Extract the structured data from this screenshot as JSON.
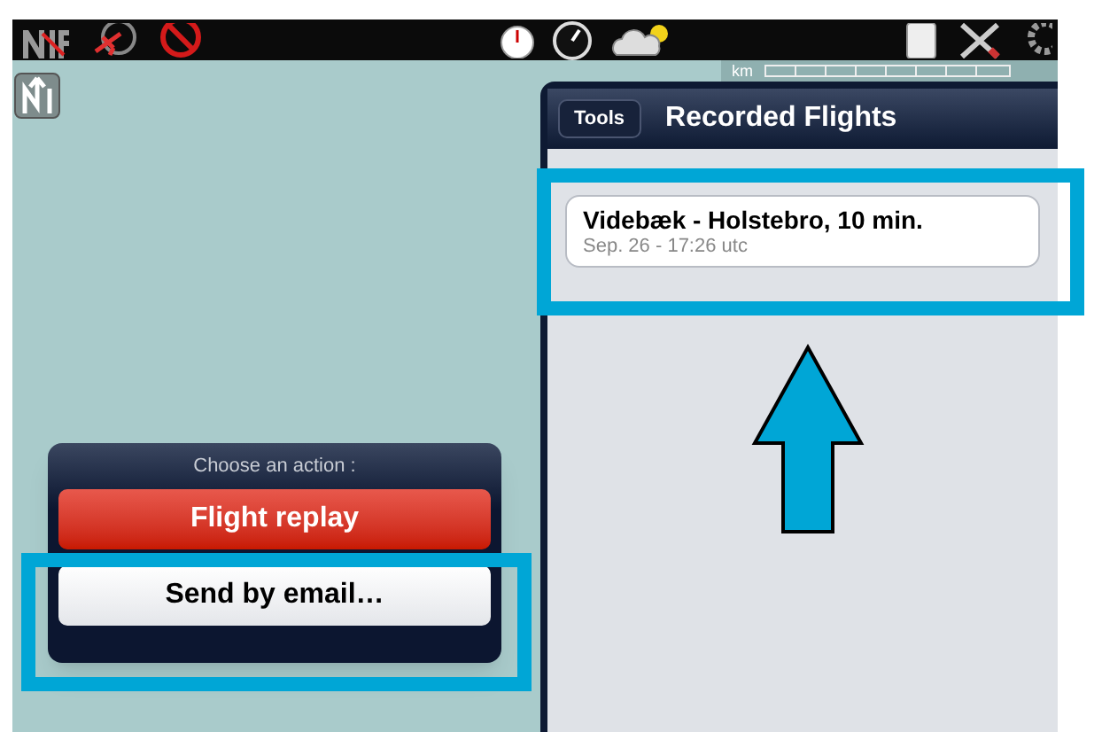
{
  "map": {
    "scale_unit": "km"
  },
  "popover": {
    "back_button": "Tools",
    "title": "Recorded Flights",
    "flights": [
      {
        "title": "Videbæk - Holstebro, 10 min.",
        "subtitle": "Sep. 26 - 17:26 utc"
      }
    ]
  },
  "action_sheet": {
    "title": "Choose an action :",
    "buttons": [
      {
        "label": "Flight replay",
        "kind": "destructive"
      },
      {
        "label": "Send by email…",
        "kind": "default"
      }
    ]
  },
  "annotations": [
    {
      "kind": "frame"
    },
    {
      "kind": "frame"
    },
    {
      "kind": "arrow"
    }
  ]
}
